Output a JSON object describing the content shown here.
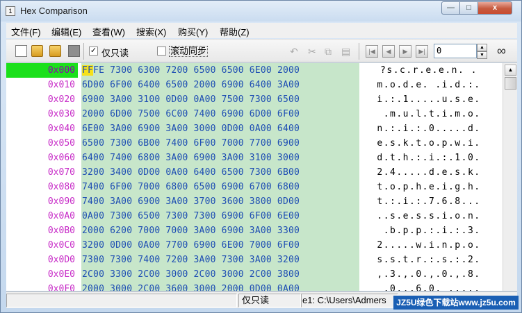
{
  "window": {
    "title": "Hex Comparison",
    "app_icon": "document-icon",
    "minimize_symbol": "—",
    "maximize_symbol": "□",
    "close_symbol": "x"
  },
  "menu": [
    "文件(F)",
    "编辑(E)",
    "查看(W)",
    "搜索(X)",
    "购买(Y)",
    "帮助(Z)"
  ],
  "toolbar": {
    "readonly_label": "仅只读",
    "readonly_checked": true,
    "scroll_sync_label": "滚动同步",
    "scroll_sync_checked": false,
    "offset_value": "0",
    "icons": [
      "new-file-icon",
      "open-file-icon",
      "open-file-2-icon",
      "stop-icon",
      "undo-icon",
      "cut-icon",
      "copy-icon",
      "paste-icon",
      "first-icon",
      "prev-icon",
      "next-icon",
      "last-icon",
      "binoculars-icon"
    ]
  },
  "rows": [
    {
      "addr": "0x000",
      "hex_rest": "FE 7300 6300 7200 6500 6500 6E00 2000",
      "hex_first": "FF",
      "ascii": "?s.c.r.e.e.n. ."
    },
    {
      "addr": "0x010",
      "hex": "6D00 6F00 6400 6500 2000 6900 6400 3A00",
      "ascii": "m.o.d.e. .i.d.:."
    },
    {
      "addr": "0x020",
      "hex": "6900 3A00 3100 0D00 0A00 7500 7300 6500",
      "ascii": "i.:.1.....u.s.e."
    },
    {
      "addr": "0x030",
      "hex": "2000 6D00 7500 6C00 7400 6900 6D00 6F00",
      "ascii": " .m.u.l.t.i.m.o."
    },
    {
      "addr": "0x040",
      "hex": "6E00 3A00 6900 3A00 3000 0D00 0A00 6400",
      "ascii": "n.:.i.:.0.....d."
    },
    {
      "addr": "0x050",
      "hex": "6500 7300 6B00 7400 6F00 7000 7700 6900",
      "ascii": "e.s.k.t.o.p.w.i."
    },
    {
      "addr": "0x060",
      "hex": "6400 7400 6800 3A00 6900 3A00 3100 3000",
      "ascii": "d.t.h.:.i.:.1.0."
    },
    {
      "addr": "0x070",
      "hex": "3200 3400 0D00 0A00 6400 6500 7300 6B00",
      "ascii": "2.4.....d.e.s.k."
    },
    {
      "addr": "0x080",
      "hex": "7400 6F00 7000 6800 6500 6900 6700 6800",
      "ascii": "t.o.p.h.e.i.g.h."
    },
    {
      "addr": "0x090",
      "hex": "7400 3A00 6900 3A00 3700 3600 3800 0D00",
      "ascii": "t.:.i.:.7.6.8..."
    },
    {
      "addr": "0x0A0",
      "hex": "0A00 7300 6500 7300 7300 6900 6F00 6E00",
      "ascii": "..s.e.s.s.i.o.n."
    },
    {
      "addr": "0x0B0",
      "hex": "2000 6200 7000 7000 3A00 6900 3A00 3300",
      "ascii": " .b.p.p.:.i.:.3."
    },
    {
      "addr": "0x0C0",
      "hex": "3200 0D00 0A00 7700 6900 6E00 7000 6F00",
      "ascii": "2.....w.i.n.p.o."
    },
    {
      "addr": "0x0D0",
      "hex": "7300 7300 7400 7200 3A00 7300 3A00 3200",
      "ascii": "s.s.t.r.:.s.:.2."
    },
    {
      "addr": "0x0E0",
      "hex": "2C00 3300 2C00 3000 2C00 3000 2C00 3800",
      "ascii": ",.3.,.0.,.0.,.8."
    },
    {
      "addr": "0x0F0",
      "hex": "2000 3000 2C00 3600 3000 2000 0D00 0A00",
      "ascii": " .0.,.6.0. ....."
    }
  ],
  "status": {
    "pane1": "",
    "pane2": "仅只读",
    "pane3": "e1: C:\\Users\\Admers"
  },
  "watermark": "JZ5U绿色下载站www.jz5u.com",
  "colors": {
    "hex_bg": "#c7e6ca",
    "hex_text": "#1d4db3",
    "addr_text": "#c72ac7",
    "selected_addr_bg": "#1be01b",
    "cursor_bg": "#f5e11a"
  }
}
